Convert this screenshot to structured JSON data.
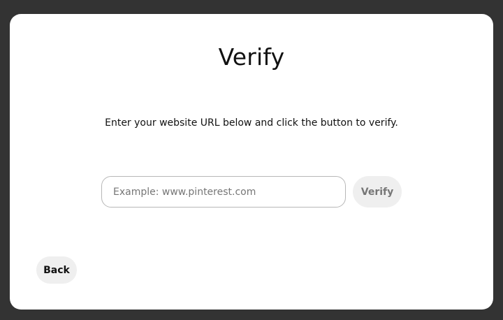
{
  "modal": {
    "title": "Verify",
    "description": "Enter your website URL below and click the button to verify.",
    "url_input": {
      "value": "",
      "placeholder": "Example: www.pinterest.com"
    },
    "verify_label": "Verify",
    "back_label": "Back"
  }
}
